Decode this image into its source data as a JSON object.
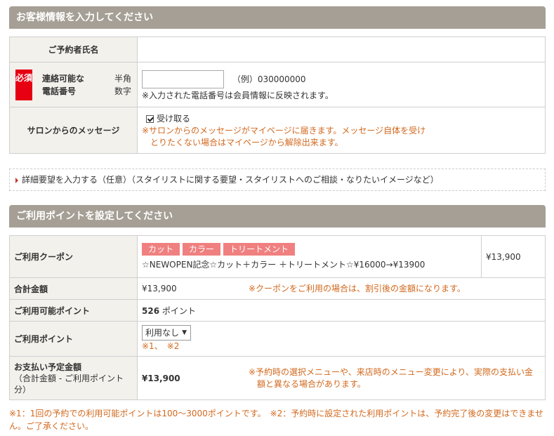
{
  "customer_section": {
    "header": "お客様情報を入力してください",
    "name_label": "ご予約者氏名",
    "required_badge": "必須",
    "phone_label": "連絡可能な電話番号",
    "phone_label_line1": "連絡可能な",
    "phone_label_line2": "電話番号",
    "phone_hint_line1": "半角",
    "phone_hint_line2": "数字",
    "phone_value": "",
    "phone_example": "（例）030000000",
    "phone_note": "※入力された電話番号は会員情報に反映されます。",
    "message_label": "サロンからのメッセージ",
    "message_checkbox_label": "受け取る",
    "message_note_line1": "※サロンからのメッセージがマイページに届きます。メッセージ自体を受け",
    "message_note_line2": "とりたくない場合はマイページから解除出来ます。"
  },
  "detail_request": {
    "label": "詳細要望を入力する（任意）（スタイリストに関する要望・スタイリストへのご相談・なりたいイメージなど）"
  },
  "points_section": {
    "header": "ご利用ポイントを設定してください",
    "coupon_label": "ご利用クーポン",
    "coupon_tags": [
      "カット",
      "カラー",
      "トリートメント"
    ],
    "coupon_text": "☆NEWOPEN記念☆カット＋カラー ＋トリートメント☆¥16000→¥13900",
    "coupon_price": "¥13,900",
    "total_label": "合計金額",
    "total_value": "¥13,900",
    "total_note": "※クーポンをご利用の場合は、割引後の金額になります。",
    "available_label": "ご利用可能ポイント",
    "available_value": "526",
    "available_unit": "ポイント",
    "use_label": "ご利用ポイント",
    "use_select_value": "利用なし",
    "use_note": "※1、　※2",
    "pay_label": "お支払い予定金額",
    "pay_sublabel_line1": "（合計金額 - ご利用ポイント",
    "pay_sublabel_line2": "分）",
    "pay_value": "¥13,900",
    "pay_note_line1": "※予約時の選択メニューや、来店時のメニュー変更により、実際の支払い金",
    "pay_note_line2": "額と異なる場合があります。"
  },
  "footer_note": "※1：1回の予約での利用可能ポイントは100～3000ポイントです。　※2：予約時に設定された利用ポイントは、予約完了後の変更はできません。ご了承ください。",
  "colors": {
    "header_bg": "#a59f95",
    "label_bg": "#f3f1ec",
    "required_red": "#e60012",
    "note_orange": "#d2691e",
    "tag_pink": "#f08080"
  }
}
